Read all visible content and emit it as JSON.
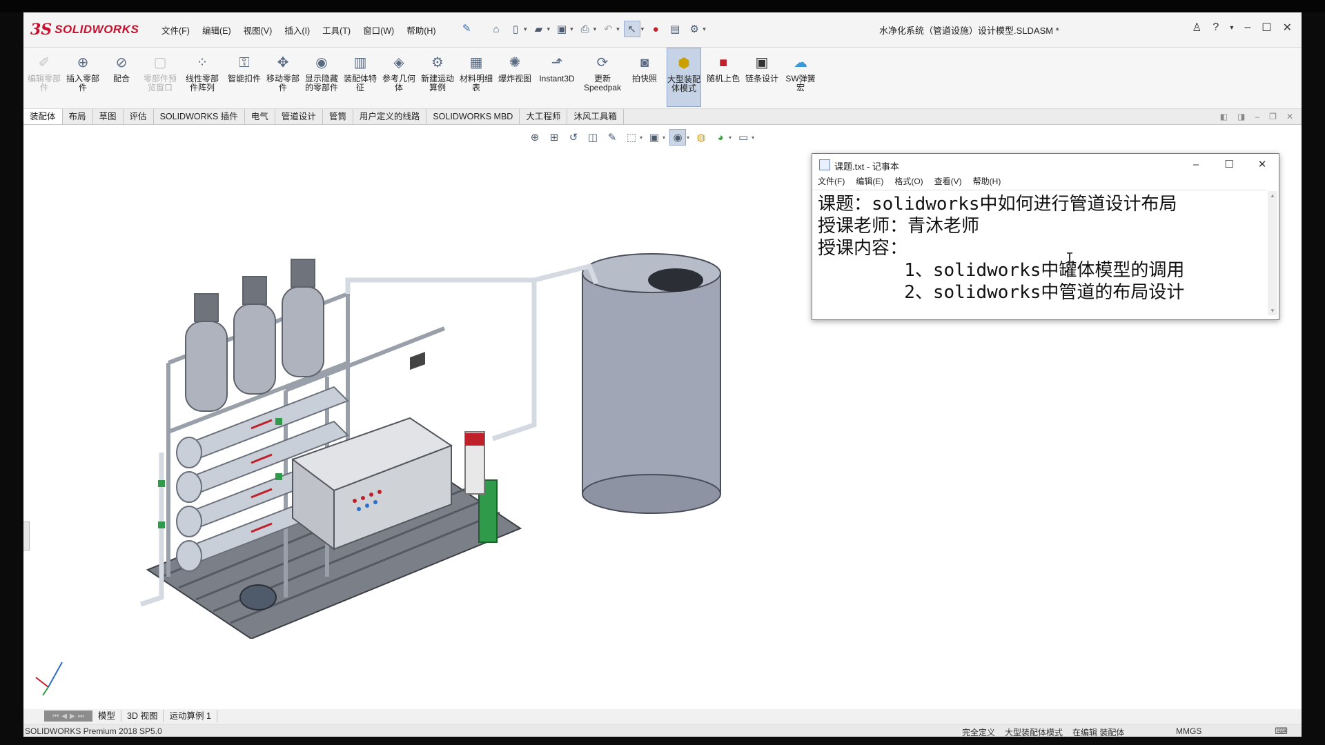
{
  "app": {
    "logo_mark": "3S",
    "logo_text": "SOLIDWORKS",
    "doc_title": "水净化系统（管道设施）设计模型.SLDASM *",
    "menus": [
      "文件(F)",
      "编辑(E)",
      "视图(V)",
      "插入(I)",
      "工具(T)",
      "窗口(W)",
      "帮助(H)"
    ]
  },
  "ribbon": [
    {
      "label": "编辑零部件",
      "icon": "edit-component-icon",
      "disabled": true
    },
    {
      "label": "插入零部件",
      "icon": "insert-component-icon",
      "disabled": false
    },
    {
      "label": "配合",
      "icon": "mate-icon",
      "disabled": false
    },
    {
      "label": "零部件预览窗口",
      "icon": "component-preview-icon",
      "disabled": true
    },
    {
      "label": "线性零部件阵列",
      "icon": "linear-pattern-icon",
      "disabled": false
    },
    {
      "label": "智能扣件",
      "icon": "smart-fasteners-icon",
      "disabled": false
    },
    {
      "label": "移动零部件",
      "icon": "move-component-icon",
      "disabled": false
    },
    {
      "label": "显示隐藏的零部件",
      "icon": "show-hidden-icon",
      "disabled": false
    },
    {
      "label": "装配体特征",
      "icon": "assembly-features-icon",
      "disabled": false
    },
    {
      "label": "参考几何体",
      "icon": "reference-geometry-icon",
      "disabled": false
    },
    {
      "label": "新建运动算例",
      "icon": "new-motion-study-icon",
      "disabled": false
    },
    {
      "label": "材料明细表",
      "icon": "bill-of-materials-icon",
      "disabled": false
    },
    {
      "label": "爆炸视图",
      "icon": "exploded-view-icon",
      "disabled": false
    },
    {
      "label": "Instant3D",
      "icon": "instant3d-icon",
      "disabled": false
    },
    {
      "label": "更新Speedpak",
      "icon": "update-speedpak-icon",
      "disabled": false
    },
    {
      "label": "拍快照",
      "icon": "snapshot-icon",
      "disabled": false
    },
    {
      "label": "大型装配体模式",
      "icon": "large-assembly-icon",
      "disabled": false,
      "active": true
    },
    {
      "label": "随机上色",
      "icon": "random-color-icon",
      "disabled": false
    },
    {
      "label": "链条设计",
      "icon": "chain-design-icon",
      "disabled": false
    },
    {
      "label": "SW弹簧宏",
      "icon": "spring-macro-icon",
      "disabled": false
    }
  ],
  "tabs": [
    "装配体",
    "布局",
    "草图",
    "评估",
    "SOLIDWORKS 插件",
    "电气",
    "管道设计",
    "管筒",
    "用户定义的线路",
    "SOLIDWORKS MBD",
    "大工程师",
    "沐风工具箱"
  ],
  "bottom_tabs": [
    "模型",
    "3D 视图",
    "运动算例 1"
  ],
  "status": {
    "left": "SOLIDWORKS Premium 2018 SP5.0",
    "items": [
      "完全定义",
      "大型装配体模式",
      "在编辑 装配体"
    ],
    "units": "MMGS"
  },
  "notepad": {
    "title": "课题.txt - 记事本",
    "menu": [
      "文件(F)",
      "编辑(E)",
      "格式(O)",
      "查看(V)",
      "帮助(H)"
    ],
    "lines": [
      "课题：solidworks中如何进行管道设计布局",
      "授课老师：青沐老师",
      "授课内容：",
      "        1、solidworks中罐体模型的调用",
      "        2、solidworks中管道的布局设计"
    ]
  },
  "colors": {
    "brand": "#c8102e",
    "tank": "#a0a6b6",
    "pipe": "#c9cfd8",
    "valve_green": "#2f9a4a",
    "accent_red": "#c0202a"
  }
}
